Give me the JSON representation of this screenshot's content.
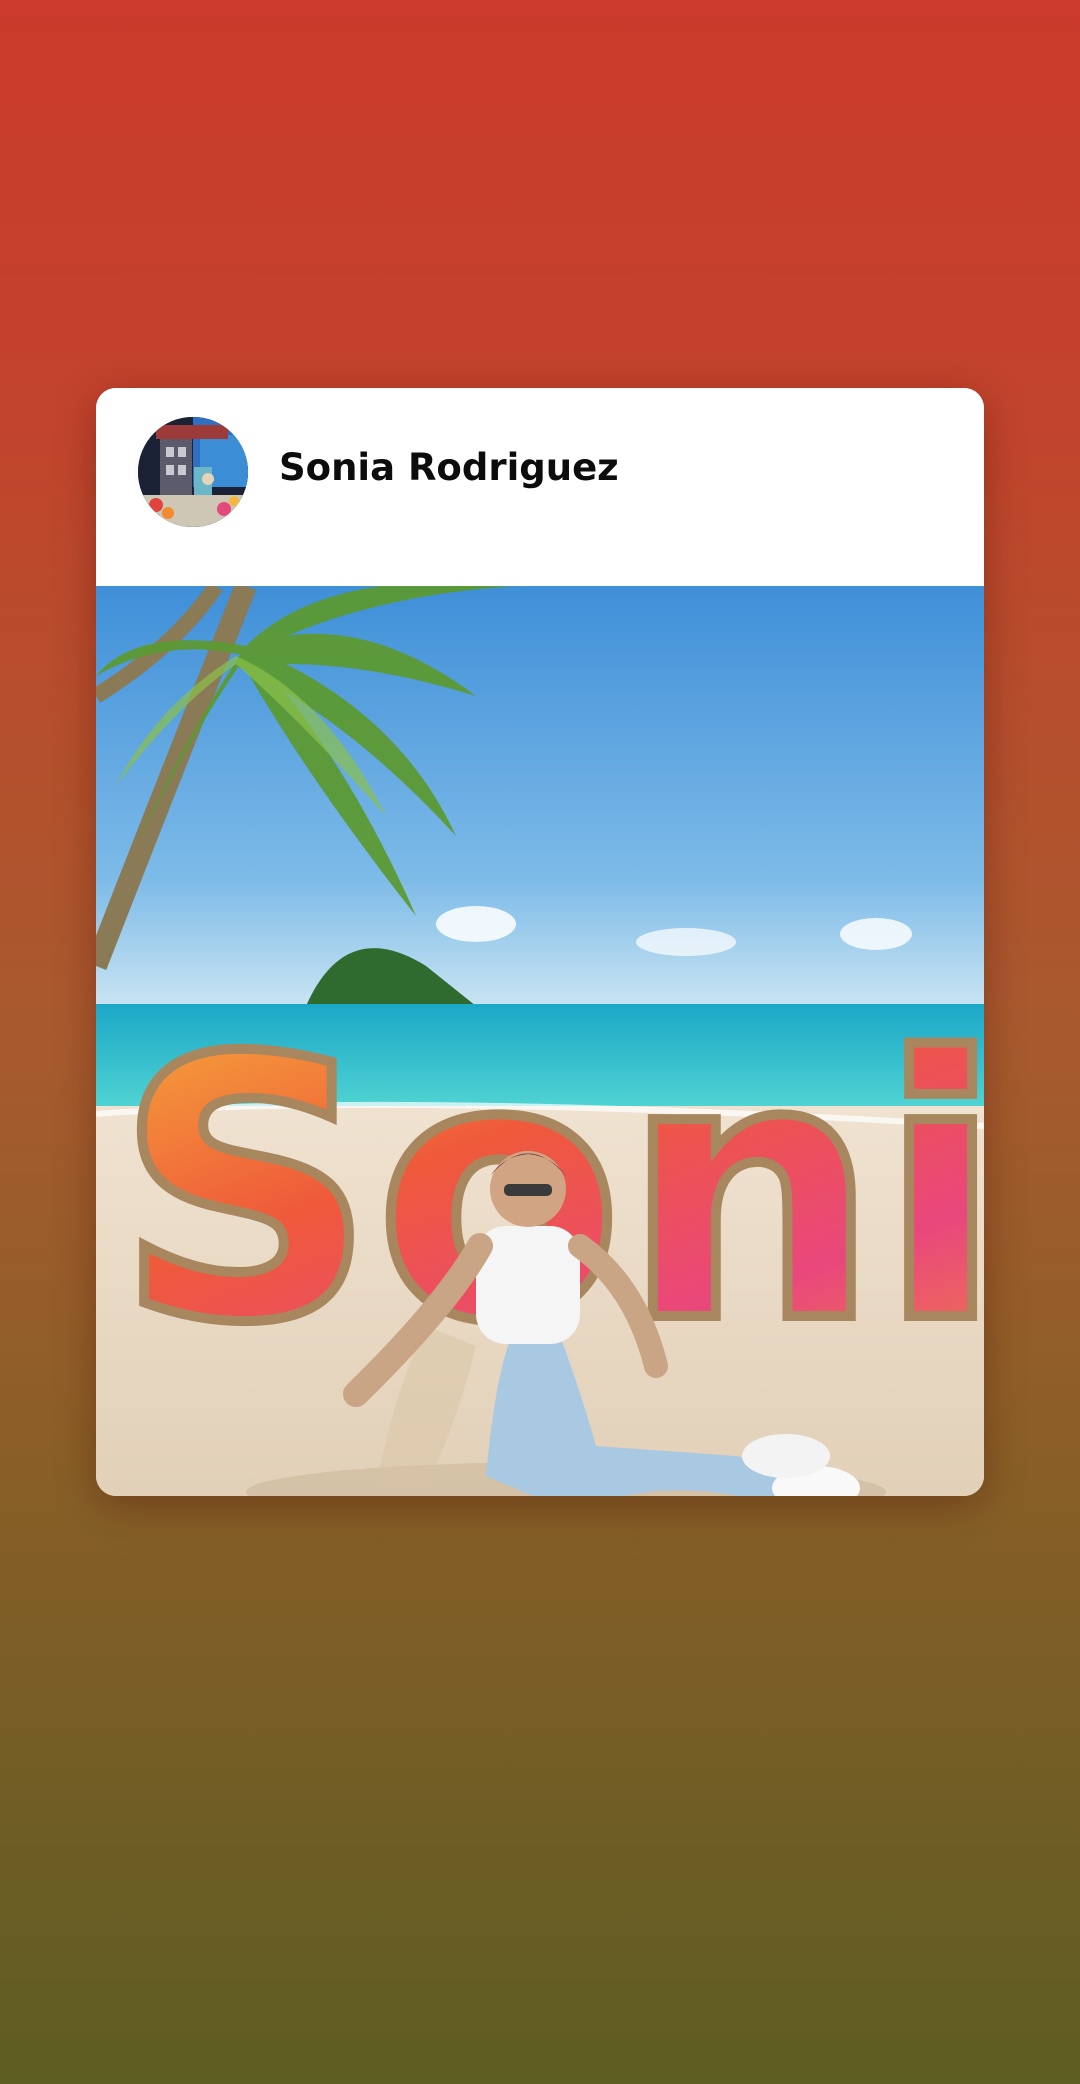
{
  "post": {
    "author_name": "Sonia Rodriguez",
    "avatar_icon": "profile-photo",
    "image": {
      "description_icon": "photo",
      "lettering": "Sonia"
    }
  },
  "colors": {
    "background_top": "#cb3a2c",
    "background_bottom": "#5e5d22",
    "card": "#ffffff",
    "name_text": "#0c0c0c",
    "sky": "#4a97d8",
    "sea": "#2cc6cf",
    "sand": "#e9dac6"
  }
}
